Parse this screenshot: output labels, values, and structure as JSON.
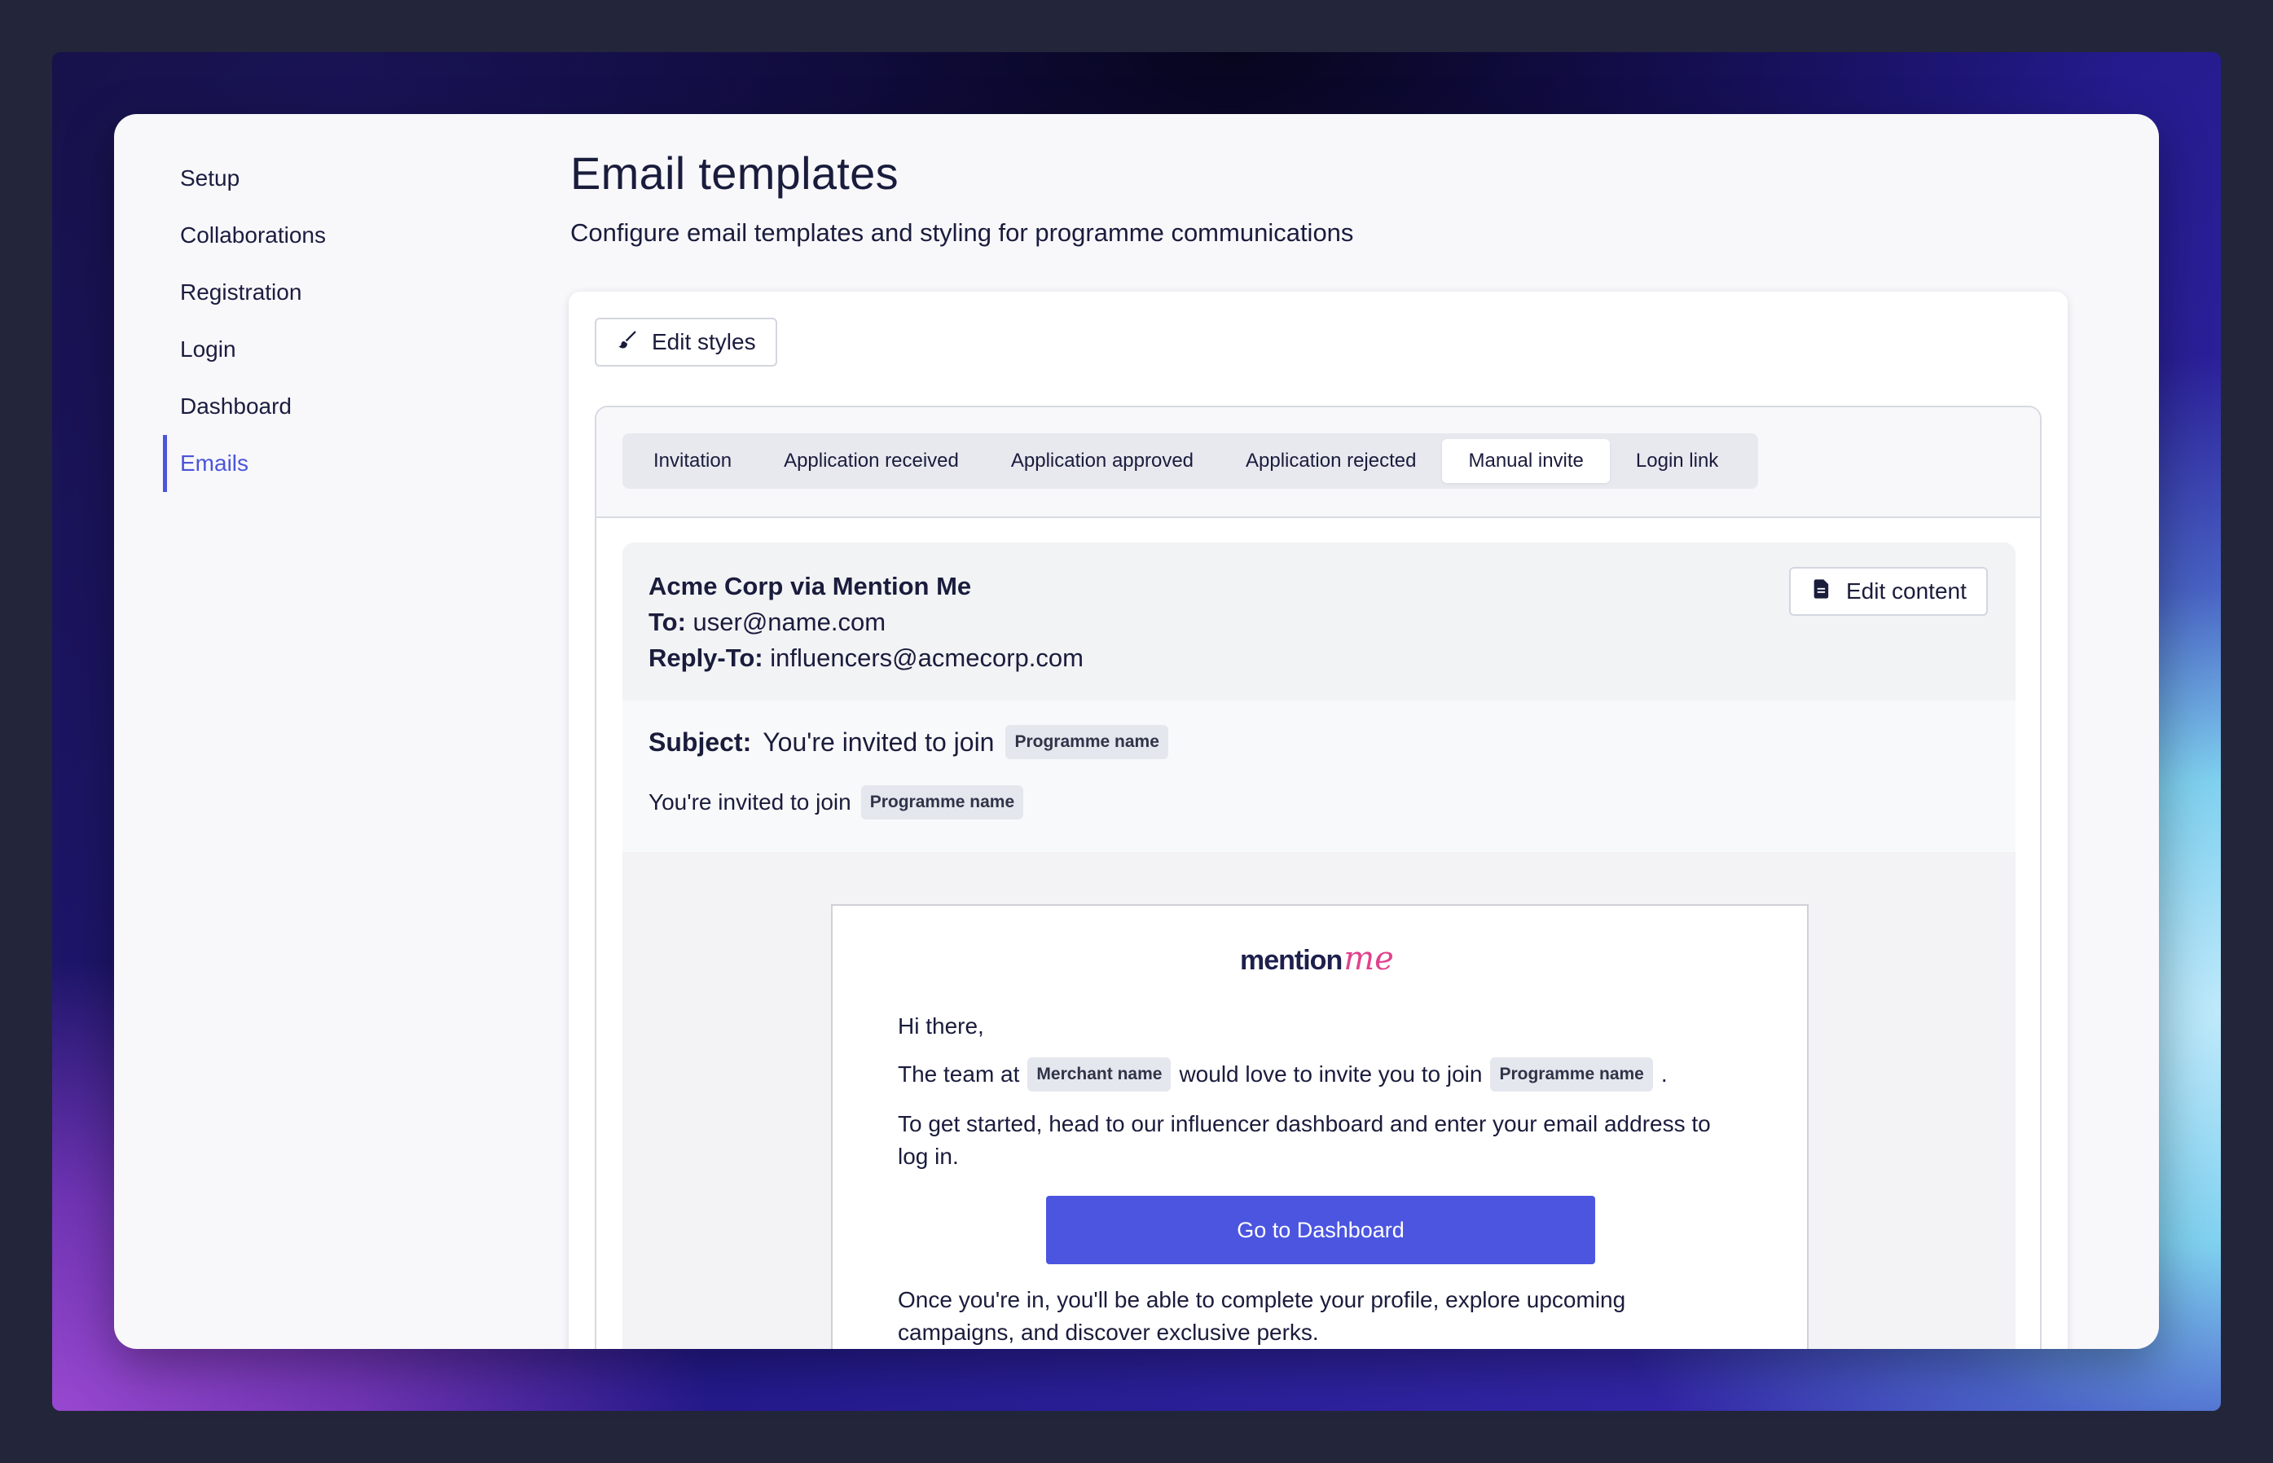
{
  "sidebar": {
    "items": [
      {
        "label": "Setup"
      },
      {
        "label": "Collaborations"
      },
      {
        "label": "Registration"
      },
      {
        "label": "Login"
      },
      {
        "label": "Dashboard"
      },
      {
        "label": "Emails",
        "active": true
      }
    ]
  },
  "page": {
    "title": "Email templates",
    "subtitle": "Configure email templates and styling for programme communications"
  },
  "toolbar": {
    "edit_styles_label": "Edit styles"
  },
  "tabs": [
    {
      "label": "Invitation"
    },
    {
      "label": "Application received"
    },
    {
      "label": "Application approved"
    },
    {
      "label": "Application rejected"
    },
    {
      "label": "Manual invite",
      "active": true
    },
    {
      "label": "Login link"
    }
  ],
  "email": {
    "from": "Acme Corp via Mention Me",
    "to_label": "To:",
    "to": "user@name.com",
    "reply_to_label": "Reply-To:",
    "reply_to": "influencers@acmecorp.com",
    "edit_content_label": "Edit content",
    "subject_label": "Subject:",
    "subject_text": "You're invited to join",
    "preheader_text": "You're invited to join",
    "programme_chip": "Programme name",
    "merchant_chip": "Merchant name",
    "body": {
      "logo_text": "mention",
      "logo_accent": "me",
      "greeting": "Hi there,",
      "line1_a": "The team at",
      "line1_b": "would love to invite you to join",
      "line1_end": ".",
      "line2": "To get started, head to our influencer dashboard and enter your email address to log in.",
      "cta_label": "Go to Dashboard",
      "line3": "Once you're in, you'll be able to complete your profile, explore upcoming campaigns, and discover exclusive perks."
    }
  },
  "colors": {
    "accent": "#4b55d8",
    "cta": "#4b55e0",
    "logo_pink": "#e0428e",
    "text": "#1a1c3c"
  }
}
